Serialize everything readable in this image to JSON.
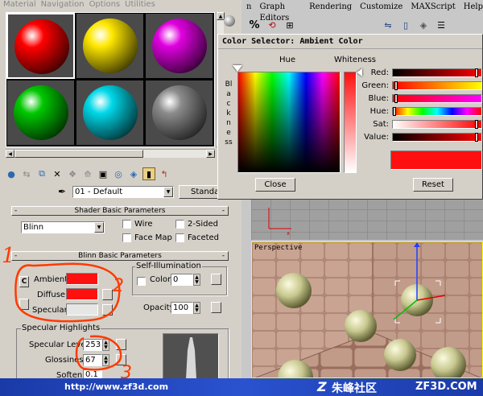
{
  "material_editor": {
    "menu": [
      "Material",
      "Navigation",
      "Options",
      "Utilities"
    ],
    "spheres": [
      {
        "name": "red",
        "color": "#ff0000"
      },
      {
        "name": "yellow",
        "color": "#ffe800"
      },
      {
        "name": "magenta",
        "color": "#e000e0"
      },
      {
        "name": "green",
        "color": "#00c800"
      },
      {
        "name": "cyan",
        "color": "#00d8e8"
      },
      {
        "name": "gray",
        "color": "#8c8c8c"
      }
    ],
    "material_name": "01 - Default",
    "material_type_button": "Standa",
    "shader_rollout": {
      "title": "Shader Basic Parameters",
      "shader": "Blinn",
      "wire": "Wire",
      "two_sided": "2-Sided",
      "face_map": "Face Map",
      "faceted": "Faceted"
    },
    "blinn_rollout": {
      "title": "Blinn Basic Parameters",
      "ambient_label": "Ambient:",
      "diffuse_label": "Diffuse:",
      "specular_label": "Specular:",
      "ambient_color": "#ff1010",
      "diffuse_color": "#ff1010",
      "specular_color": "#e6e6e6",
      "lock_letter": "C",
      "self_illum": "Self-Illumination",
      "color_label": "Color",
      "color_value": "0",
      "opacity_label": "Opacity:",
      "opacity_value": "100"
    },
    "spec_highlights": {
      "title": "Specular Highlights",
      "level_label": "Specular Level:",
      "level_value": "253",
      "gloss_label": "Glossiness:",
      "gloss_value": "67",
      "soften_label": "Soften:",
      "soften_value": "0.1"
    }
  },
  "main_menu": [
    "n",
    "Graph Editors",
    "Rendering",
    "Customize",
    "MAXScript",
    "Help"
  ],
  "color_selector": {
    "title": "Color Selector: Ambient Color",
    "hue_label": "Hue",
    "whiteness_label": "Whiteness",
    "blackness_label": "Blackness",
    "channels": [
      {
        "label": "Red:",
        "value": 0.98
      },
      {
        "label": "Green:",
        "value": 0.02
      },
      {
        "label": "Blue:",
        "value": 0.02
      },
      {
        "label": "Hue:",
        "value": 0.0
      },
      {
        "label": "Sat:",
        "value": 0.98
      },
      {
        "label": "Value:",
        "value": 0.98
      }
    ],
    "swatch_color": "#ff1010",
    "close_label": "Close",
    "reset_label": "Reset"
  },
  "viewport": {
    "label": "Perspective"
  },
  "watermark": {
    "url": "http://www.zf3d.com",
    "site_cn": "朱峰社区",
    "site_en": "ZF3D.COM"
  },
  "annotations": {
    "num1": "1",
    "num2": "2",
    "num3": "3",
    "ink_color": "#ff3a00"
  }
}
